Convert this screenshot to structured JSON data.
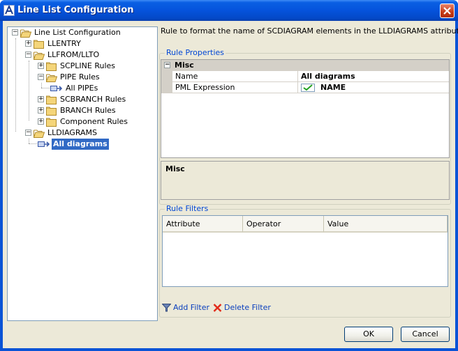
{
  "window": {
    "title": "Line List Configuration"
  },
  "tree": {
    "root": "Line List Configuration",
    "llentry": "LLENTRY",
    "llfrom": "LLFROM/LLTO",
    "scpline": "SCPLINE Rules",
    "pipe_rules": "PIPE Rules",
    "all_pipes": "All PIPEs",
    "scbranch": "SCBRANCH Rules",
    "branch": "BRANCH Rules",
    "component": "Component Rules",
    "lldiagrams": "LLDIAGRAMS",
    "all_diagrams": "All diagrams"
  },
  "description": "Rule to format the name of SCDIAGRAM elements in the LLDIAGRAMS attribute.",
  "rule_properties": {
    "legend": "Rule Properties",
    "category": "Misc",
    "rows": [
      {
        "name": "Name",
        "value": "All diagrams"
      },
      {
        "name": "PML Expression",
        "value": "NAME"
      }
    ]
  },
  "info": {
    "title": "Misc"
  },
  "rule_filters": {
    "legend": "Rule Filters",
    "columns": [
      "Attribute",
      "Operator",
      "Value"
    ]
  },
  "actions": {
    "add_filter": "Add Filter",
    "delete_filter": "Delete Filter"
  },
  "buttons": {
    "ok": "OK",
    "cancel": "Cancel"
  },
  "colors": {
    "accent": "#0a53d6",
    "selection": "#316ac5",
    "link": "#0a3fbe",
    "folder": "#f4d57a"
  },
  "icons": {
    "window": "app-icon",
    "close": "close-icon",
    "folder": "folder-icon",
    "rule": "rule-icon",
    "check": "check-icon",
    "funnel": "funnel-icon",
    "delete": "red-x-icon"
  }
}
